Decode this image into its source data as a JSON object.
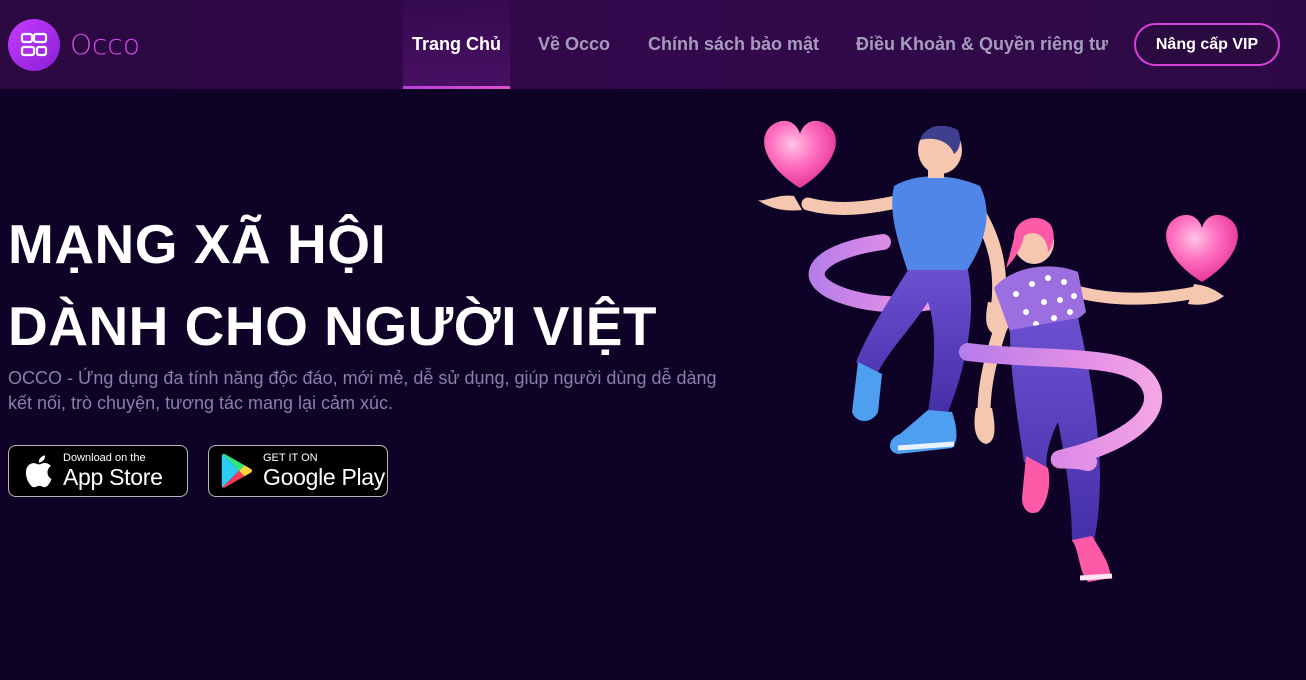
{
  "header": {
    "brand": "Occo",
    "nav": [
      {
        "label": "Trang Chủ",
        "active": true
      },
      {
        "label": "Về Occo",
        "active": false
      },
      {
        "label": "Chính sách bảo mật",
        "active": false
      },
      {
        "label": "Điều Khoản & Quyền riêng tư",
        "active": false
      }
    ],
    "vip_label": "Nâng cấp VIP"
  },
  "hero": {
    "title_line1": "MẠNG XÃ HỘI",
    "title_line2": "DÀNH CHO NGƯỜI VIỆT",
    "description": "OCCO - Ứng dụng đa tính năng độc đáo, mới mẻ, dễ sử dụng, giúp người dùng dễ dàng kết nối, trò chuyện, tương tác mang lại cảm xúc."
  },
  "stores": {
    "apple": {
      "small": "Download on the",
      "big": "App Store",
      "icon": "apple-icon"
    },
    "google": {
      "small": "GET IT ON",
      "big": "Google Play",
      "icon": "google-play-icon"
    }
  },
  "colors": {
    "background": "#0e0327",
    "header": "#2d0a46",
    "accent": "#d83fd9",
    "muted_text": "#8a7fa5"
  }
}
